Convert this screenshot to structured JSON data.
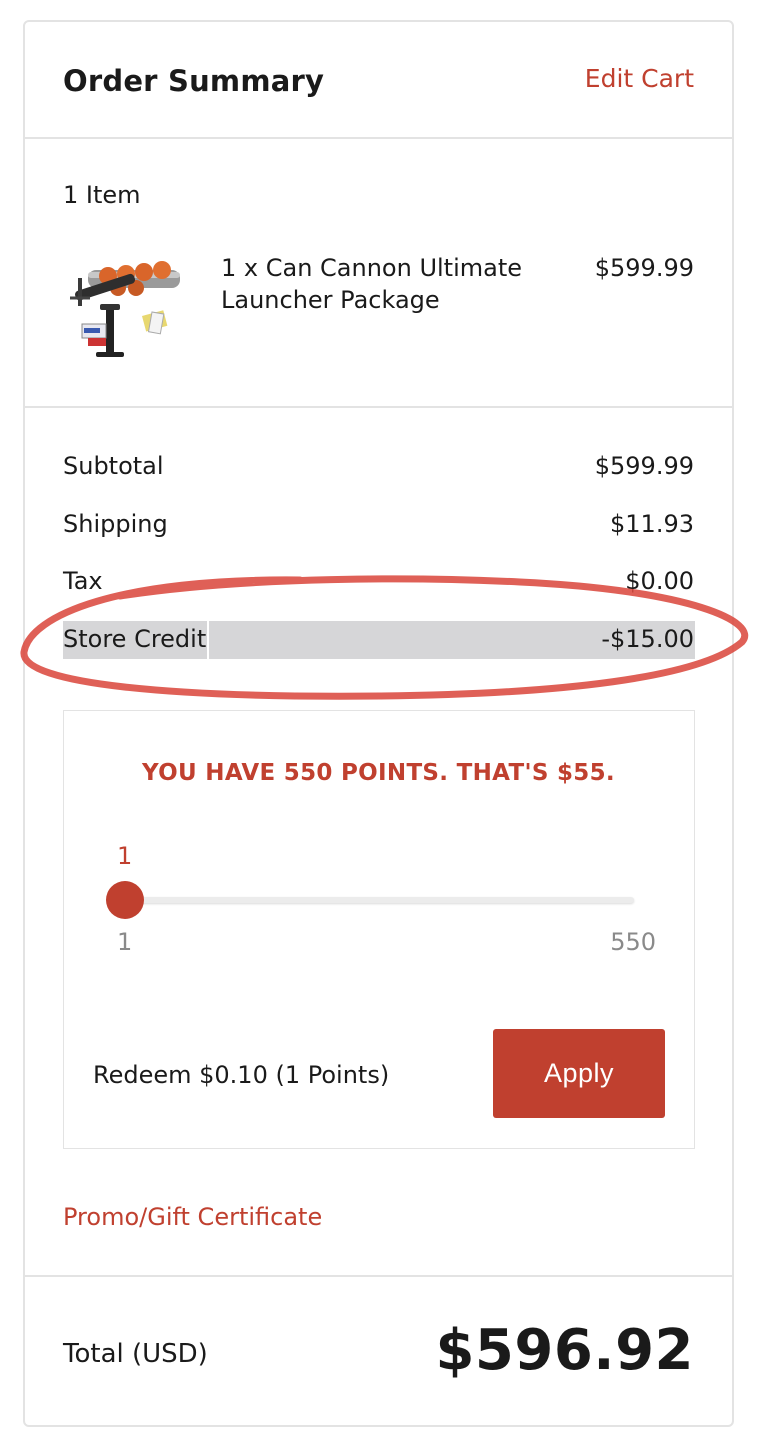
{
  "header": {
    "title": "Order Summary",
    "edit_cart": "Edit Cart"
  },
  "items": {
    "count_label": "1 Item",
    "list": [
      {
        "name": "1 x Can Cannon Ultimate Launcher Package",
        "price": "$599.99",
        "image_icon": "can-cannon-launcher-product-image"
      }
    ]
  },
  "totals": {
    "subtotal_label": "Subtotal",
    "subtotal": "$599.99",
    "shipping_label": "Shipping",
    "shipping": "$11.93",
    "tax_label": "Tax",
    "tax": "$0.00",
    "store_credit_label": "Store Credit",
    "store_credit": "-$15.00"
  },
  "points": {
    "title": "YOU HAVE 550 POINTS. THAT'S $55.",
    "slider_value": "1",
    "slider_min": "1",
    "slider_max": "550",
    "slider_fraction": 0.0,
    "redeem_text": "Redeem $0.10 (1 Points)",
    "apply_label": "Apply"
  },
  "promo": {
    "label": "Promo/Gift Certificate"
  },
  "total": {
    "label": "Total (USD)",
    "value": "$596.92"
  },
  "colors": {
    "accent": "#c0402f",
    "highlight": "#d6d6d8",
    "annotation": "#d9443a"
  }
}
